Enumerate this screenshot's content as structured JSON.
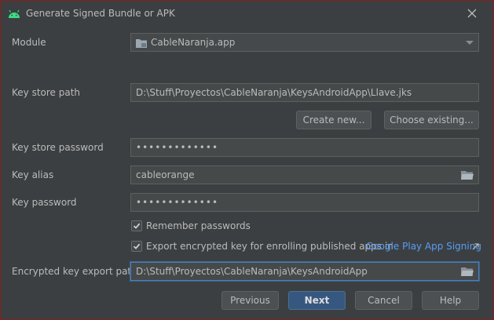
{
  "window": {
    "title": "Generate Signed Bundle or APK"
  },
  "module": {
    "label": "Module",
    "value": "CableNaranja.app"
  },
  "keystore": {
    "path_label": "Key store path",
    "path_value": "D:\\Stuff\\Proyectos\\CableNaranja\\KeysAndroidApp\\Llave.jks",
    "create_new_label": "Create new...",
    "choose_existing_label": "Choose existing...",
    "password_label": "Key store password",
    "password_value": "•••••••••••••"
  },
  "key": {
    "alias_label": "Key alias",
    "alias_value": "cableorange",
    "password_label": "Key password",
    "password_value": "•••••••••••••"
  },
  "options": {
    "remember_label": "Remember passwords",
    "remember_checked": true,
    "export_label": "Export encrypted key for enrolling published apps in",
    "export_checked": true,
    "export_link": "Google Play App Signing"
  },
  "export_path": {
    "label": "Encrypted key export path",
    "value": "D:\\Stuff\\Proyectos\\CableNaranja\\KeysAndroidApp"
  },
  "footer": {
    "previous_label": "Previous",
    "next_label": "Next",
    "cancel_label": "Cancel",
    "help_label": "Help"
  },
  "colors": {
    "background": "#3c3f41",
    "field": "#45494a",
    "primary_button": "#365880",
    "link": "#589df6",
    "android_green": "#3ddc84"
  },
  "icons": {
    "logo": "android-icon",
    "close": "close-icon",
    "module": "module-folder-icon",
    "browse": "folder-icon",
    "external": "external-link-icon"
  }
}
